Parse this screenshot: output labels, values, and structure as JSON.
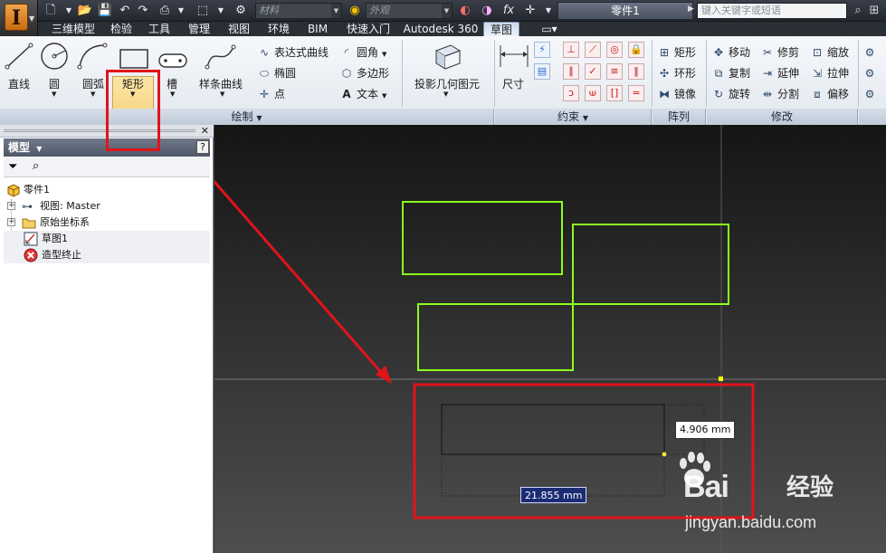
{
  "window": {
    "doc_title": "零件1",
    "search_placeholder": "键入关键字或短语",
    "material_placeholder": "材料",
    "appearance_placeholder": "外观",
    "fx_label": "fx"
  },
  "tabs": [
    {
      "label": "三维模型"
    },
    {
      "label": "检验"
    },
    {
      "label": "工具"
    },
    {
      "label": "管理"
    },
    {
      "label": "视图"
    },
    {
      "label": "环境"
    },
    {
      "label": "BIM"
    },
    {
      "label": "快速入门"
    },
    {
      "label": "Autodesk 360"
    },
    {
      "label": "草图"
    }
  ],
  "active_tab": "草图",
  "ribbon": {
    "draw": {
      "title": "绘制",
      "line": "直线",
      "circle": "圆",
      "arc": "圆弧",
      "rectangle": "矩形",
      "slot": "槽",
      "spline": "样条曲线",
      "equation_curve": "表达式曲线",
      "ellipse": "椭圆",
      "point": "点",
      "fillet": "圆角",
      "polygon": "多边形",
      "text": "文本",
      "project_geometry": "投影几何图元"
    },
    "constrain": {
      "title": "约束",
      "dimension": "尺寸"
    },
    "pattern": {
      "title": "阵列",
      "rect": "矩形",
      "circular": "环形",
      "mirror": "镜像"
    },
    "modify": {
      "title": "修改",
      "move": "移动",
      "trim": "修剪",
      "scale": "缩放",
      "copy": "复制",
      "extend": "延伸",
      "stretch": "拉伸",
      "rotate": "旋转",
      "split": "分割",
      "offset": "偏移"
    }
  },
  "browser": {
    "title": "模型",
    "help": "?",
    "tree": [
      {
        "label": "零件1",
        "icon": "part-icon"
      },
      {
        "label": "视图: Master",
        "icon": "view-icon"
      },
      {
        "label": "原始坐标系",
        "icon": "folder-icon"
      },
      {
        "label": "草图1",
        "icon": "sketch-icon"
      },
      {
        "label": "造型终止",
        "icon": "end-of-part-icon"
      }
    ]
  },
  "canvas": {
    "dim_height": "4.906 mm",
    "dim_width": "21.855 mm"
  },
  "watermark": {
    "brand": "Bai",
    "brand_tail": "经验",
    "url": "jingyan.baidu.com"
  },
  "colors": {
    "accent_red": "#e0141a",
    "sketch_green": "#8cff1a",
    "active_tab_blue": "#c9d8ea"
  }
}
